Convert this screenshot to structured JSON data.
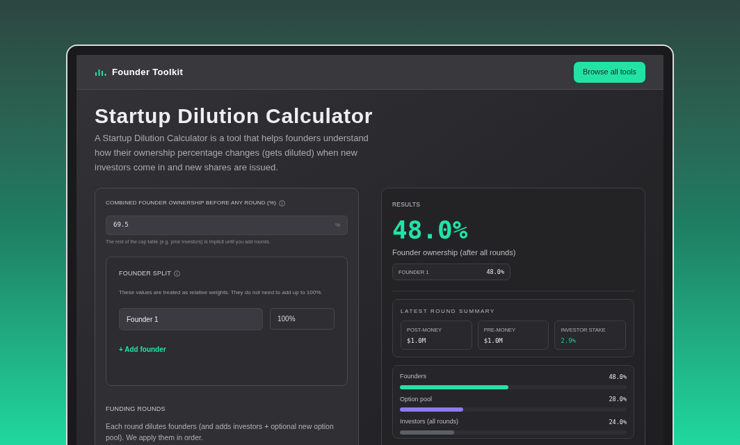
{
  "header": {
    "brand": "Founder Toolkit",
    "button": "Browse all tools"
  },
  "title": "Startup Dilution Calculator",
  "description": "A Startup Dilution Calculator is a tool that helps founders understand how their ownership percentage changes (gets diluted) when new investors come in and new shares are issued.",
  "inputs": {
    "ownership_label": "COMBINED FOUNDER OWNERSHIP BEFORE ANY ROUND (%)",
    "ownership_value": "69.5",
    "ownership_unit": "%",
    "ownership_hint": "The rest of the cap table (e.g. prior investors) is implicit until you add rounds.",
    "founder_split": {
      "title": "FOUNDER SPLIT",
      "note": "These values are treated as relative weights. They do not need to add up to 100%.",
      "founders": [
        {
          "name": "Founder 1",
          "weight": "100%"
        }
      ],
      "add_link": "+ Add founder"
    },
    "funding_rounds": {
      "title": "FUNDING ROUNDS",
      "note": "Each round dilutes founders (and adds investors + optional new option pool). We apply them in order."
    }
  },
  "results": {
    "title": "RESULTS",
    "headline": "48.0%",
    "caption": "Founder ownership (after all rounds)",
    "founders": [
      {
        "name": "FOUNDER 1",
        "value": "48.0%"
      }
    ],
    "summary": {
      "title": "LATEST ROUND SUMMARY",
      "stats": [
        {
          "label": "POST-MONEY",
          "value": "$1.0M",
          "highlight": false
        },
        {
          "label": "PRE-MONEY",
          "value": "$1.0M",
          "highlight": false
        },
        {
          "label": "INVESTOR STAKE",
          "value": "2.9%",
          "highlight": true
        }
      ]
    },
    "breakdown": [
      {
        "label": "Founders",
        "value": "48.0%",
        "level": 0.48,
        "color": "#22e3a4"
      },
      {
        "label": "Option pool",
        "value": "28.0%",
        "level": 0.28,
        "color": "#8b7cf0"
      },
      {
        "label": "Investors (all rounds)",
        "value": "24.0%",
        "level": 0.24,
        "color": "#5d5f66"
      }
    ]
  }
}
